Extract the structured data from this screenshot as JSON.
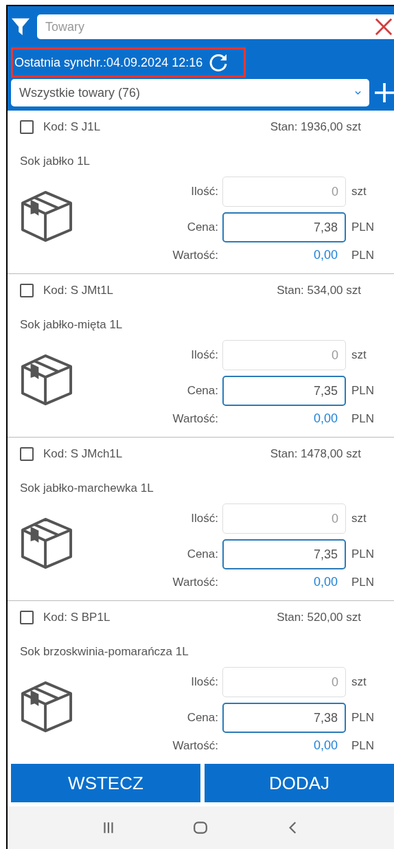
{
  "search": {
    "placeholder": "Towary"
  },
  "sync": {
    "text": "Ostatnia synchr.:04.09.2024 12:16",
    "highlighted": true
  },
  "filter": {
    "value": "Wszystkie towary (76)"
  },
  "items": [
    {
      "checked": false,
      "code": "Kod: S J1L",
      "stock": "Stan: 1936,00 szt",
      "name": "Sok jabłko 1L",
      "qty_label": "Ilość:",
      "qty_placeholder": "0",
      "qty_unit": "szt",
      "price_label": "Cena:",
      "price": "7,38",
      "price_unit": "PLN",
      "value_label": "Wartość:",
      "value": "0,00",
      "value_unit": "PLN"
    },
    {
      "checked": false,
      "code": "Kod: S JMt1L",
      "stock": "Stan: 534,00 szt",
      "name": "Sok jabłko-mięta 1L",
      "qty_label": "Ilość:",
      "qty_placeholder": "0",
      "qty_unit": "szt",
      "price_label": "Cena:",
      "price": "7,35",
      "price_unit": "PLN",
      "value_label": "Wartość:",
      "value": "0,00",
      "value_unit": "PLN"
    },
    {
      "checked": false,
      "code": "Kod: S JMch1L",
      "stock": "Stan: 1478,00 szt",
      "name": "Sok jabłko-marchewka 1L",
      "qty_label": "Ilość:",
      "qty_placeholder": "0",
      "qty_unit": "szt",
      "price_label": "Cena:",
      "price": "7,35",
      "price_unit": "PLN",
      "value_label": "Wartość:",
      "value": "0,00",
      "value_unit": "PLN"
    },
    {
      "checked": false,
      "code": "Kod: S BP1L",
      "stock": "Stan: 520,00 szt",
      "name": "Sok brzoskwinia-pomarańcza 1L",
      "qty_label": "Ilość:",
      "qty_placeholder": "0",
      "qty_unit": "szt",
      "price_label": "Cena:",
      "price": "7,38",
      "price_unit": "PLN",
      "value_label": "Wartość:",
      "value": "0,00",
      "value_unit": "PLN"
    }
  ],
  "buttons": [
    "WSTECZ",
    "DODAJ"
  ]
}
